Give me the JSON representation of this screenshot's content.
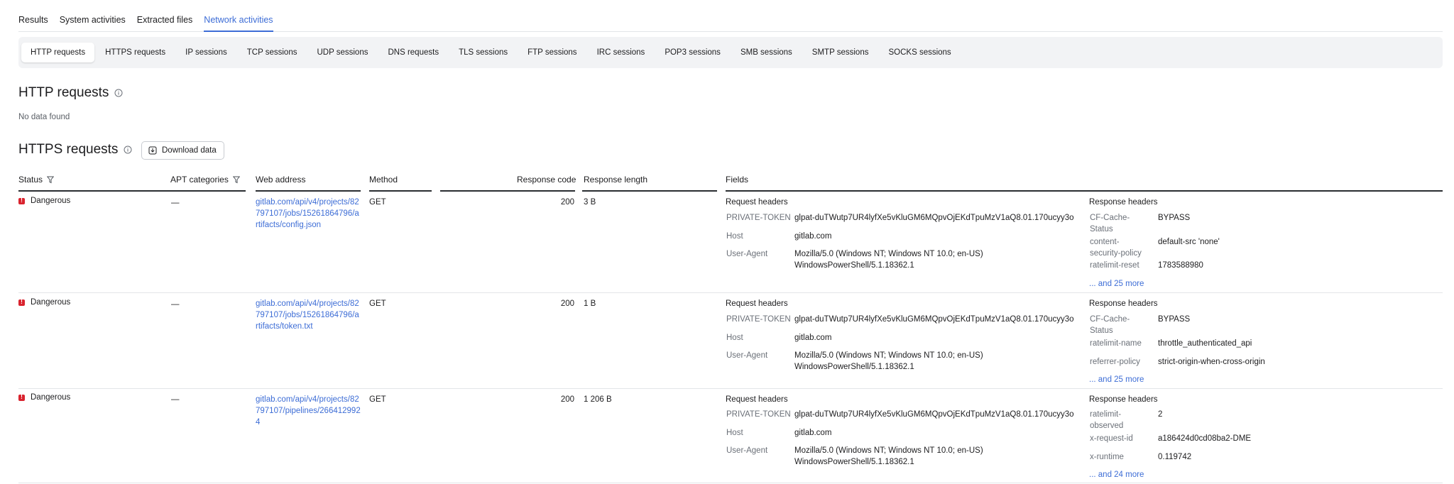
{
  "top_tabs": [
    "Results",
    "System activities",
    "Extracted files",
    "Network activities"
  ],
  "sub_tabs": [
    "HTTP requests",
    "HTTPS requests",
    "IP sessions",
    "TCP sessions",
    "UDP sessions",
    "DNS requests",
    "TLS sessions",
    "FTP sessions",
    "IRC sessions",
    "POP3 sessions",
    "SMB sessions",
    "SMTP sessions",
    "SOCKS sessions"
  ],
  "http_section": {
    "title": "HTTP requests",
    "empty_text": "No data found"
  },
  "https_section": {
    "title": "HTTPS requests",
    "download_label": "Download data"
  },
  "columns": {
    "status": "Status",
    "apt": "APT categories",
    "web": "Web address",
    "method": "Method",
    "response_code": "Response code",
    "response_length": "Response length",
    "fields": "Fields"
  },
  "field_group_labels": {
    "request": "Request headers",
    "response": "Response headers"
  },
  "rows": [
    {
      "status": "Dangerous",
      "apt": "—",
      "url": "gitlab.com/api/v4/projects/82797107/jobs/15261864796/artifacts/config.json",
      "method": "GET",
      "code": "200",
      "length": "3 B",
      "req": [
        {
          "k": "PRIVATE-TOKEN",
          "v": "glpat-duTWutp7UR4lyfXe5vKluGM6MQpvOjEKdTpuMzV1aQ8.01.170ucyy3o"
        },
        {
          "k": "Host",
          "v": "gitlab.com"
        },
        {
          "k": "User-Agent",
          "v": "Mozilla/5.0 (Windows NT; Windows NT 10.0; en-US)",
          "v2": "WindowsPowerShell/5.1.18362.1"
        }
      ],
      "resp": [
        {
          "k": "CF-Cache-",
          "k2": "Status",
          "v": "BYPASS"
        },
        {
          "k": "content-",
          "k2": "security-policy",
          "v": "default-src 'none'"
        },
        {
          "k": "ratelimit-reset",
          "v": "1783588980"
        }
      ],
      "more": "... and 25 more"
    },
    {
      "status": "Dangerous",
      "apt": "—",
      "url": "gitlab.com/api/v4/projects/82797107/jobs/15261864796/artifacts/token.txt",
      "method": "GET",
      "code": "200",
      "length": "1 B",
      "req": [
        {
          "k": "PRIVATE-TOKEN",
          "v": "glpat-duTWutp7UR4lyfXe5vKluGM6MQpvOjEKdTpuMzV1aQ8.01.170ucyy3o"
        },
        {
          "k": "Host",
          "v": "gitlab.com"
        },
        {
          "k": "User-Agent",
          "v": "Mozilla/5.0 (Windows NT; Windows NT 10.0; en-US)",
          "v2": "WindowsPowerShell/5.1.18362.1"
        }
      ],
      "resp": [
        {
          "k": "CF-Cache-",
          "k2": "Status",
          "v": "BYPASS"
        },
        {
          "k": "ratelimit-name",
          "v": "throttle_authenticated_api"
        },
        {
          "k": "referrer-policy",
          "v": "strict-origin-when-cross-origin"
        }
      ],
      "more": "... and 25 more"
    },
    {
      "status": "Dangerous",
      "apt": "—",
      "url": "gitlab.com/api/v4/projects/82797107/pipelines/2664129924",
      "method": "GET",
      "code": "200",
      "length": "1 206 B",
      "req": [
        {
          "k": "PRIVATE-TOKEN",
          "v": "glpat-duTWutp7UR4lyfXe5vKluGM6MQpvOjEKdTpuMzV1aQ8.01.170ucyy3o"
        },
        {
          "k": "Host",
          "v": "gitlab.com"
        },
        {
          "k": "User-Agent",
          "v": "Mozilla/5.0 (Windows NT; Windows NT 10.0; en-US)",
          "v2": "WindowsPowerShell/5.1.18362.1"
        }
      ],
      "resp": [
        {
          "k": "ratelimit-",
          "k2": "observed",
          "v": "2"
        },
        {
          "k": "x-request-id",
          "v": "a186424d0cd08ba2-DME"
        },
        {
          "k": "x-runtime",
          "v": "0.119742"
        }
      ],
      "more": "... and 24 more"
    }
  ]
}
